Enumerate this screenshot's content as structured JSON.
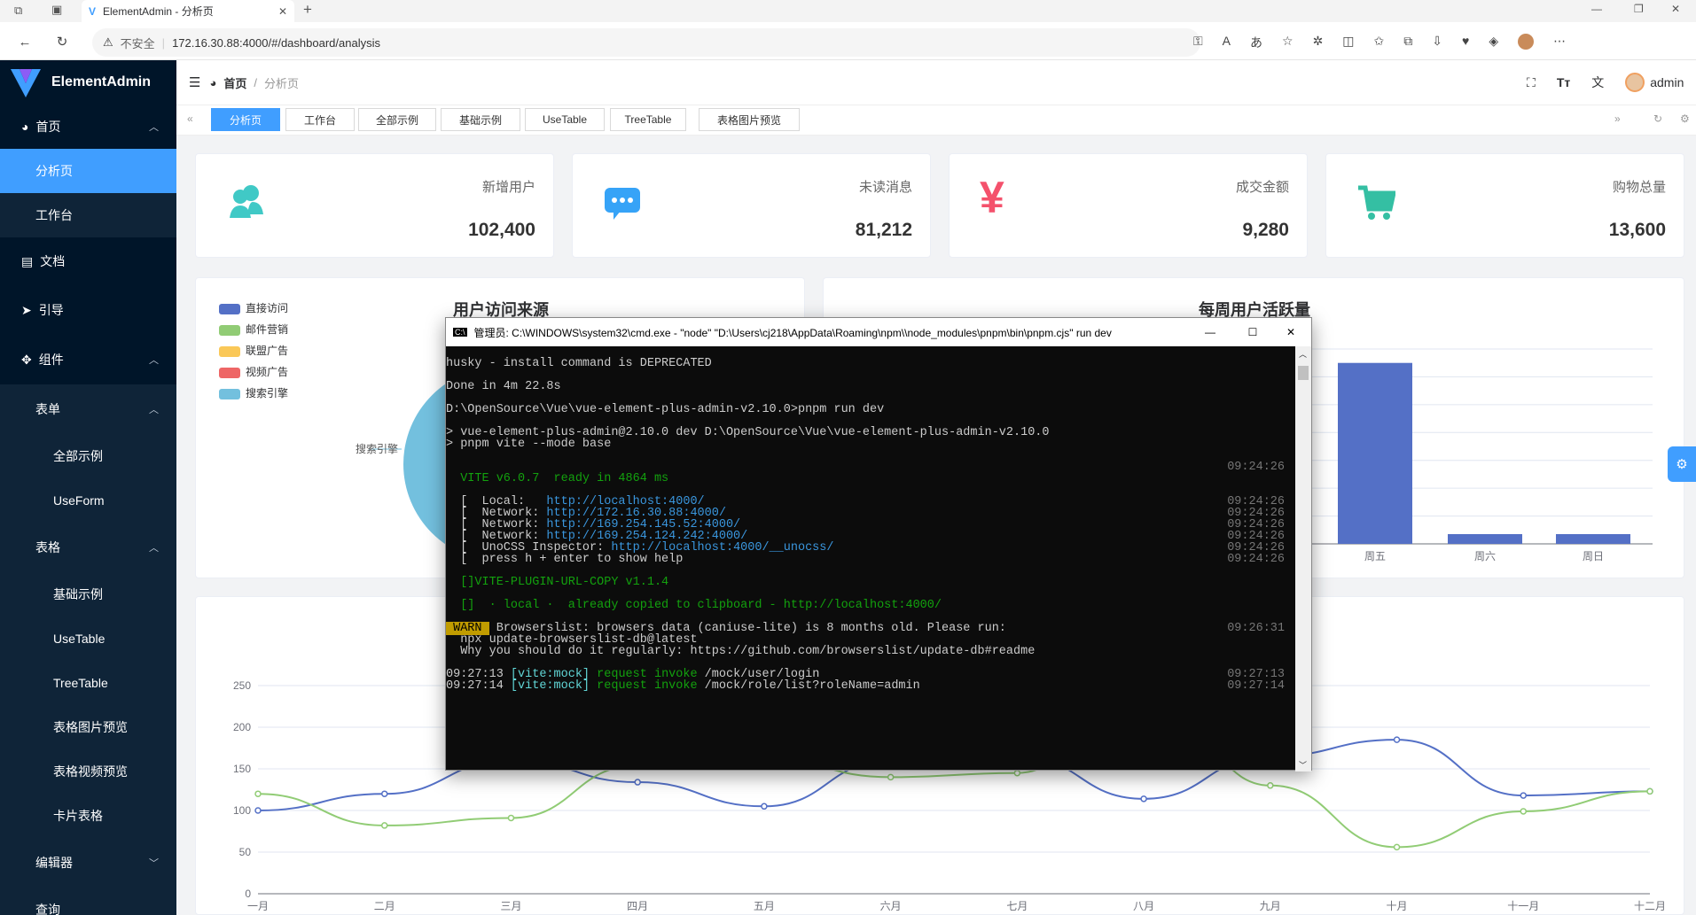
{
  "browser": {
    "tab_title": "ElementAdmin - 分析页",
    "url": "172.16.30.88:4000/#/dashboard/analysis",
    "insecure": "不安全"
  },
  "app": {
    "name": "ElementAdmin"
  },
  "header": {
    "breadcrumb_home": "首页",
    "breadcrumb_current": "分析页",
    "user": "admin",
    "separator": "/"
  },
  "sidebar": {
    "items": [
      {
        "label": "首页"
      },
      {
        "label": "分析页"
      },
      {
        "label": "工作台"
      },
      {
        "label": "文档"
      },
      {
        "label": "引导"
      },
      {
        "label": "组件"
      },
      {
        "label": "表单"
      },
      {
        "label": "全部示例"
      },
      {
        "label": "UseForm"
      },
      {
        "label": "表格"
      },
      {
        "label": "基础示例"
      },
      {
        "label": "UseTable"
      },
      {
        "label": "TreeTable"
      },
      {
        "label": "表格图片预览"
      },
      {
        "label": "表格视频预览"
      },
      {
        "label": "卡片表格"
      },
      {
        "label": "编辑器"
      },
      {
        "label": "查询"
      }
    ]
  },
  "tags": [
    "分析页",
    "工作台",
    "全部示例",
    "基础示例",
    "UseTable",
    "TreeTable",
    "表格图片预览"
  ],
  "stats": [
    {
      "label": "新增用户",
      "value": "102,400",
      "color": "#40c9c6",
      "icon": "users-icon"
    },
    {
      "label": "未读消息",
      "value": "81,212",
      "color": "#36a3f7",
      "icon": "message-icon"
    },
    {
      "label": "成交金额",
      "value": "9,280",
      "color": "#f4516c",
      "icon": "yen-icon"
    },
    {
      "label": "购物总量",
      "value": "13,600",
      "color": "#34bfa3",
      "icon": "cart-icon"
    }
  ],
  "pie": {
    "title": "用户访问来源",
    "legend": [
      "直接访问",
      "邮件营销",
      "联盟广告",
      "视频广告",
      "搜索引擎"
    ],
    "colors": [
      "#5470c6",
      "#91cc75",
      "#fac858",
      "#ee6666",
      "#73c0de"
    ],
    "callout": "搜索引擎"
  },
  "weekly": {
    "title": "每周用户活跃量"
  },
  "chart_data": [
    {
      "type": "bar",
      "title": "每周用户活跃量",
      "categories": [
        "周五",
        "周六",
        "周日"
      ],
      "values": [
        130,
        7,
        7
      ],
      "color": "#5470c6"
    },
    {
      "type": "line",
      "categories": [
        "一月",
        "二月",
        "三月",
        "四月",
        "五月",
        "六月",
        "七月",
        "八月",
        "九月",
        "十月",
        "十一月",
        "十二月"
      ],
      "ylim": [
        0,
        250
      ],
      "yticks": [
        0,
        50,
        100,
        150,
        200,
        250
      ],
      "series": [
        {
          "values": [
            100,
            120,
            161,
            134,
            105,
            160,
            165,
            114,
            165,
            185,
            118,
            123
          ],
          "color": "#5470c6"
        },
        {
          "values": [
            120,
            82,
            91,
            154,
            162,
            140,
            145,
            250,
            130,
            56,
            99,
            123
          ],
          "color": "#91cc75"
        }
      ]
    }
  ],
  "cmd": {
    "title": "管理员: C:\\WINDOWS\\system32\\cmd.exe  - \"node\"   \"D:\\Users\\cj218\\AppData\\Roaming\\npm\\\\node_modules\\pnpm\\bin\\pnpm.cjs\" run dev",
    "lines": [
      {
        "y": 12,
        "t": "husky - install command is DEPRECATED"
      },
      {
        "y": 38,
        "t": "Done in 4m 22.8s"
      },
      {
        "y": 64,
        "t": "D:\\OpenSource\\Vue\\vue-element-plus-admin-v2.10.0>pnpm run dev"
      },
      {
        "y": 90,
        "t": "> vue-element-plus-admin@2.10.0 dev D:\\OpenSource\\Vue\\vue-element-plus-admin-v2.10.0"
      },
      {
        "y": 103,
        "t": "> pnpm vite --mode base"
      },
      {
        "y": 142,
        "t": "  VITE v6.0.7  ready in 4864 ms",
        "cls": "g"
      },
      {
        "y": 168,
        "t": "  [  Local:   http://localhost:4000/"
      },
      {
        "y": 181,
        "t": "  [  Network: http://172.16.30.88:4000/"
      },
      {
        "y": 194,
        "t": "  [  Network: http://169.254.145.52:4000/"
      },
      {
        "y": 207,
        "t": "  [  Network: http://169.254.124.242:4000/"
      },
      {
        "y": 220,
        "t": "  [  UnoCSS Inspector: http://localhost:4000/__unocss/"
      },
      {
        "y": 233,
        "t": "  [  press h + enter to show help"
      },
      {
        "y": 259,
        "t": "  []VITE-PLUGIN-URL-COPY v1.1.4",
        "cls": "g"
      },
      {
        "y": 285,
        "t": "  []  · local ·  already copied to clipboard - http://localhost:4000/",
        "cls": "g"
      },
      {
        "y": 311,
        "t": " WARN  Browserslist: browsers data (caniuse-lite) is 8 months old. Please run:"
      },
      {
        "y": 324,
        "t": "  npx update-browserslist-db@latest"
      },
      {
        "y": 337,
        "t": "  Why you should do it regularly: https://github.com/browserslist/update-db#readme"
      },
      {
        "y": 363,
        "t": "09:27:13 [vite:mock] request invoke /mock/user/login"
      },
      {
        "y": 376,
        "t": "09:27:14 [vite:mock] request invoke /mock/role/list?roleName=admin"
      }
    ],
    "times": [
      {
        "y": 129,
        "t": "09:24:26"
      },
      {
        "y": 168,
        "t": "09:24:26"
      },
      {
        "y": 181,
        "t": "09:24:26"
      },
      {
        "y": 194,
        "t": "09:24:26"
      },
      {
        "y": 207,
        "t": "09:24:26"
      },
      {
        "y": 220,
        "t": "09:24:26"
      },
      {
        "y": 233,
        "t": "09:24:26"
      },
      {
        "y": 311,
        "t": "09:26:31"
      },
      {
        "y": 363,
        "t": "09:27:13"
      },
      {
        "y": 376,
        "t": "09:27:14"
      }
    ]
  }
}
